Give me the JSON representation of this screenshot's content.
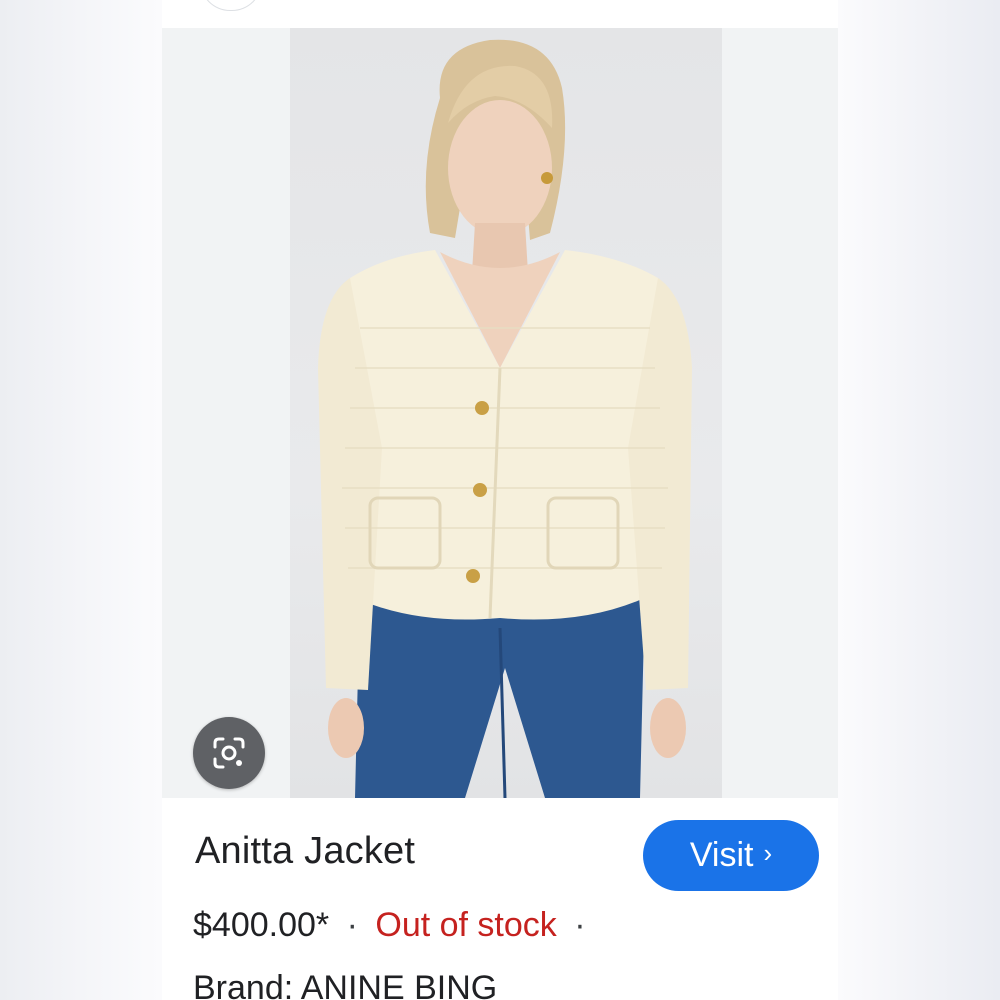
{
  "product": {
    "title": "Anitta Jacket",
    "price": "$400.00*",
    "separator_1": "·",
    "stock_status": "Out of stock",
    "separator_2": "·",
    "brand_line": "Brand: ANINE BING"
  },
  "actions": {
    "visit_label": "Visit",
    "visit_chevron": "›"
  },
  "icons": {
    "lens": "camera-lens-icon"
  },
  "colors": {
    "visit_button": "#1a73e8",
    "out_of_stock": "#c5221f",
    "lens_button": "#5f6165",
    "text": "#202124"
  }
}
